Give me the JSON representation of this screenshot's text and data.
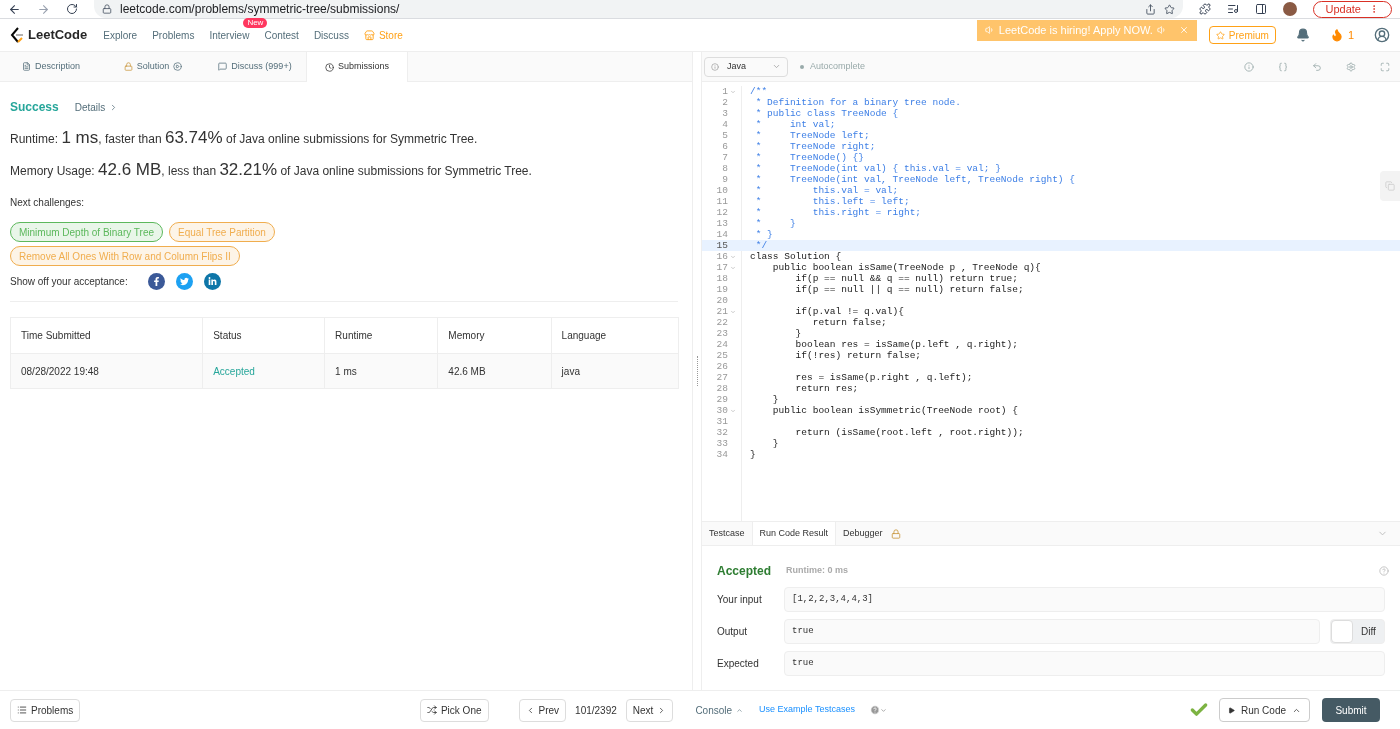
{
  "browser": {
    "url": "leetcode.com/problems/symmetric-tree/submissions/",
    "update_button": "Update"
  },
  "nav": {
    "logo": "LeetCode",
    "items": [
      {
        "label": "Explore",
        "kind": "link"
      },
      {
        "label": "Problems",
        "kind": "link"
      },
      {
        "label": "Interview",
        "kind": "link",
        "badge": "New"
      },
      {
        "label": "Contest",
        "kind": "link"
      },
      {
        "label": "Discuss",
        "kind": "link"
      },
      {
        "label": "Store",
        "kind": "store"
      }
    ],
    "banner": "LeetCode is hiring! Apply NOW.",
    "premium": "Premium",
    "streak": "1"
  },
  "tabs": [
    {
      "label": "Description",
      "selected": false
    },
    {
      "label": "Solution",
      "selected": false
    },
    {
      "label": "Discuss (999+)",
      "selected": false
    },
    {
      "label": "Submissions",
      "selected": true
    }
  ],
  "result": {
    "status": "Success",
    "details": "Details",
    "runtime": {
      "label": "Runtime:",
      "value": "1 ms",
      "middle": ", faster than",
      "percent": "63.74%",
      "tail": "of Java online submissions for Symmetric Tree."
    },
    "memory": {
      "label": "Memory Usage:",
      "value": "42.6 MB",
      "middle": ", less than",
      "percent": "32.21%",
      "tail": "of Java online submissions for Symmetric Tree."
    },
    "next_label": "Next challenges:",
    "challenges": [
      {
        "label": "Minimum Depth of Binary Tree",
        "color": "#5cb85c"
      },
      {
        "label": "Equal Tree Partition",
        "color": "#f0ad4e"
      },
      {
        "label": "Remove All Ones With Row and Column Flips II",
        "color": "#f0ad4e"
      }
    ],
    "share_label": "Show off your acceptance:"
  },
  "table": {
    "columns": [
      "Time Submitted",
      "Status",
      "Runtime",
      "Memory",
      "Language"
    ],
    "rows": [
      [
        "08/28/2022 19:48",
        "Accepted",
        "1 ms",
        "42.6 MB",
        "java"
      ]
    ]
  },
  "editor": {
    "language": "Java",
    "autocomplete": "Autocomplete",
    "lines": [
      {
        "n": "1",
        "text": "/**",
        "kind": "comment",
        "fold": true,
        "selected": false
      },
      {
        "n": "2",
        "text": " * Definition for a binary tree node.",
        "kind": "comment",
        "fold": false,
        "selected": false
      },
      {
        "n": "3",
        "text": " * public class TreeNode {",
        "kind": "comment",
        "fold": false,
        "selected": false
      },
      {
        "n": "4",
        "text": " *     int val;",
        "kind": "comment",
        "fold": false,
        "selected": false
      },
      {
        "n": "5",
        "text": " *     TreeNode left;",
        "kind": "comment",
        "fold": false,
        "selected": false
      },
      {
        "n": "6",
        "text": " *     TreeNode right;",
        "kind": "comment",
        "fold": false,
        "selected": false
      },
      {
        "n": "7",
        "text": " *     TreeNode() {}",
        "kind": "comment",
        "fold": false,
        "selected": false
      },
      {
        "n": "8",
        "text": " *     TreeNode(int val) { this.val = val; }",
        "kind": "comment",
        "fold": false,
        "selected": false
      },
      {
        "n": "9",
        "text": " *     TreeNode(int val, TreeNode left, TreeNode right) {",
        "kind": "comment",
        "fold": false,
        "selected": false
      },
      {
        "n": "10",
        "text": " *         this.val = val;",
        "kind": "comment",
        "fold": false,
        "selected": false
      },
      {
        "n": "11",
        "text": " *         this.left = left;",
        "kind": "comment",
        "fold": false,
        "selected": false
      },
      {
        "n": "12",
        "text": " *         this.right = right;",
        "kind": "comment",
        "fold": false,
        "selected": false
      },
      {
        "n": "13",
        "text": " *     }",
        "kind": "comment",
        "fold": false,
        "selected": false
      },
      {
        "n": "14",
        "text": " * }",
        "kind": "comment",
        "fold": false,
        "selected": false
      },
      {
        "n": "15",
        "text": " */",
        "kind": "comment",
        "fold": false,
        "selected": true
      },
      {
        "n": "16",
        "text": "class Solution {",
        "kind": "code",
        "fold": true,
        "selected": false
      },
      {
        "n": "17",
        "text": "    public boolean isSame(TreeNode p , TreeNode q){",
        "kind": "code",
        "fold": true,
        "selected": false
      },
      {
        "n": "18",
        "text": "        if(p == null && q == null) return true;",
        "kind": "code",
        "fold": false,
        "selected": false
      },
      {
        "n": "19",
        "text": "        if(p == null || q == null) return false;",
        "kind": "code",
        "fold": false,
        "selected": false
      },
      {
        "n": "20",
        "fold": false,
        "selected": false
      },
      {
        "n": "21",
        "text": "        if(p.val != q.val){",
        "kind": "code",
        "fold": true,
        "selected": false
      },
      {
        "n": "22",
        "text": "           return false;",
        "kind": "code",
        "fold": false,
        "selected": false
      },
      {
        "n": "23",
        "text": "        }",
        "kind": "code",
        "fold": false,
        "selected": false
      },
      {
        "n": "24",
        "text": "        boolean res = isSame(p.left , q.right);",
        "kind": "code",
        "fold": false,
        "selected": false
      },
      {
        "n": "25",
        "text": "        if(!res) return false;",
        "kind": "code",
        "fold": false,
        "selected": false
      },
      {
        "n": "26",
        "fold": false,
        "selected": false
      },
      {
        "n": "27",
        "text": "        res = isSame(p.right , q.left);",
        "kind": "code",
        "fold": false,
        "selected": false
      },
      {
        "n": "28",
        "text": "        return res;",
        "kind": "code",
        "fold": false,
        "selected": false
      },
      {
        "n": "29",
        "text": "    }",
        "kind": "code",
        "fold": false,
        "selected": false
      },
      {
        "n": "30",
        "text": "    public boolean isSymmetric(TreeNode root) {",
        "kind": "code",
        "fold": true,
        "selected": false
      },
      {
        "n": "31",
        "fold": false,
        "selected": false
      },
      {
        "n": "32",
        "text": "        return (isSame(root.left , root.right));",
        "kind": "code",
        "fold": false,
        "selected": false
      },
      {
        "n": "33",
        "text": "    }",
        "kind": "code",
        "fold": false,
        "selected": false
      },
      {
        "n": "34",
        "text": "}",
        "kind": "code",
        "fold": false,
        "selected": false
      }
    ]
  },
  "console": {
    "tabs": [
      {
        "label": "Testcase",
        "locked": false,
        "selected": false
      },
      {
        "label": "Run Code Result",
        "locked": false,
        "selected": true
      },
      {
        "label": "Debugger",
        "locked": true,
        "selected": false
      }
    ],
    "verdict": "Accepted",
    "runtime": "Runtime: 0 ms",
    "fields": [
      {
        "label": "Your input",
        "value": "[1,2,2,3,4,4,3]"
      },
      {
        "label": "Output",
        "value": "true",
        "diff": {
          "label": "Diff",
          "on": false
        }
      },
      {
        "label": "Expected",
        "value": "true"
      }
    ]
  },
  "footer": {
    "problems": "Problems",
    "pick_one": "Pick One",
    "prev": "Prev",
    "counter": "101/2392",
    "next": "Next",
    "console": "Console",
    "example": "Use Example Testcases",
    "run": "Run Code",
    "submit": "Submit"
  }
}
